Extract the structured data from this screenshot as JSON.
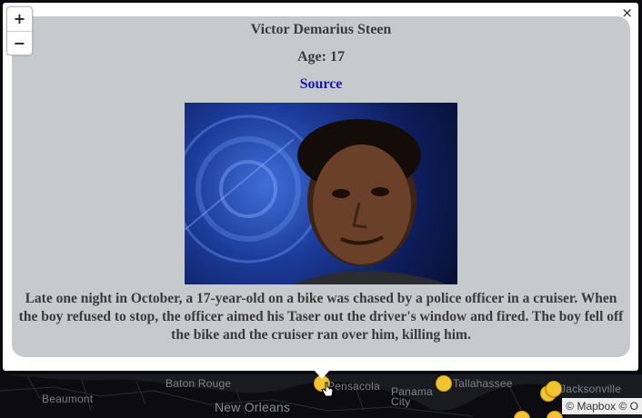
{
  "map": {
    "cities": [
      {
        "id": "baton-rouge",
        "label": "Baton Rouge"
      },
      {
        "id": "beaumont",
        "label": "Beaumont"
      },
      {
        "id": "new-orleans",
        "label": "New Orleans"
      },
      {
        "id": "pensacola",
        "label": "Pensacola"
      },
      {
        "id": "panama-city",
        "label": "Panama City"
      },
      {
        "id": "tallahassee",
        "label": "Tallahassee"
      },
      {
        "id": "jacksonville",
        "label": "Jacksonville"
      }
    ],
    "attribution": "© Mapbox © O",
    "marker_color": "#f4c430"
  },
  "zoom": {
    "in_label": "+",
    "out_label": "−"
  },
  "popup": {
    "close_label": "×",
    "name": "Victor Demarius Steen",
    "age": "Age: 17",
    "source_label": "Source",
    "description": "Late one night in October, a 17-year-old on a bike was chased by a police officer in a cruiser. When the boy refused to stop, the officer aimed his Taser out the driver's window and fired. The boy fell off the bike and the cruiser ran over him, killing him.",
    "card_bg": "#c6cacd",
    "source_color": "#1a1aa0"
  }
}
